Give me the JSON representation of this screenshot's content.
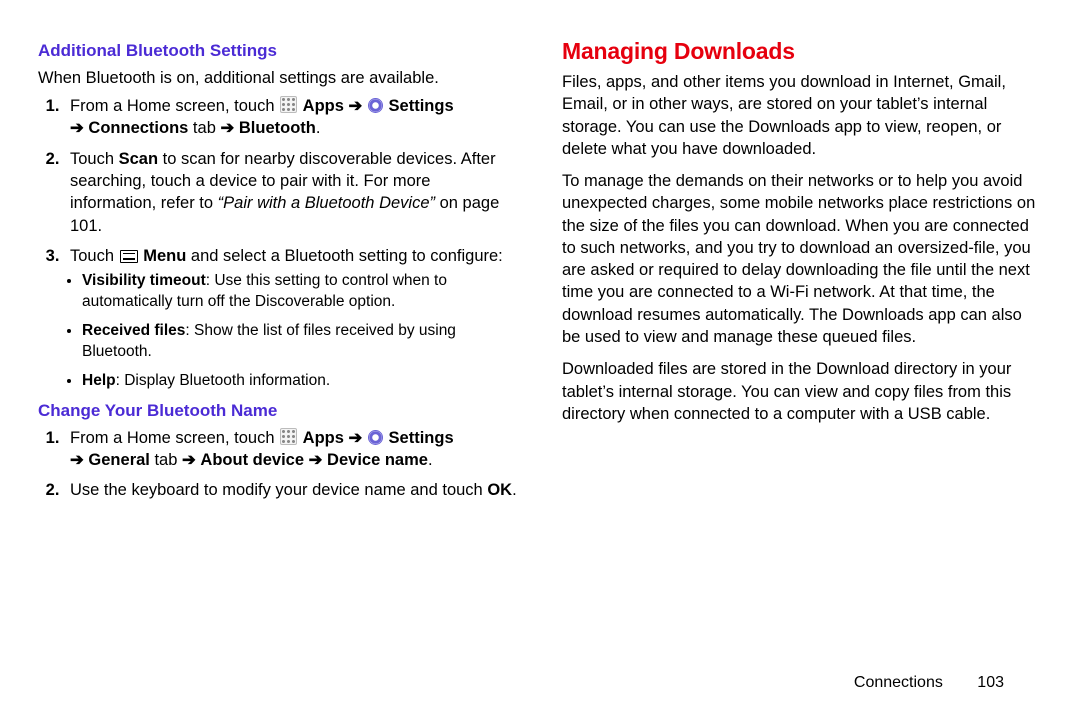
{
  "left": {
    "heading1": "Additional Bluetooth Settings",
    "intro1": "When Bluetooth is on, additional settings are available.",
    "step1_a": "From a Home screen, touch ",
    "apps": "Apps",
    "settings": "Settings",
    "step1_b": "Connections",
    "step1_c": " tab",
    "step1_d": "Bluetooth",
    "step2_a": "Touch ",
    "step2_scan": "Scan",
    "step2_b": " to scan for nearby discoverable devices. After searching, touch a device to pair with it. For more information, refer to ",
    "step2_ref": "“Pair with a Bluetooth Device”",
    "step2_c": " on page 101.",
    "step3_a": "Touch ",
    "step3_menu": "Menu",
    "step3_b": " and select a Bluetooth setting to configure:",
    "bullet1_t": "Visibility timeout",
    "bullet1_b": ": Use this setting to control when to automatically turn off the Discoverable option.",
    "bullet2_t": "Received files",
    "bullet2_b": ": Show the list of files received by using Bluetooth.",
    "bullet3_t": "Help",
    "bullet3_b": ": Display Bluetooth information.",
    "heading2": "Change Your Bluetooth Name",
    "cstep1_a": "From a Home screen, touch ",
    "cstep1_gen": "General",
    "cstep1_tab": " tab",
    "cstep1_about": "About device",
    "cstep1_dev": "Device name",
    "cstep2_a": "Use the keyboard to modify your device name and touch ",
    "cstep2_ok": "OK"
  },
  "right": {
    "heading": "Managing Downloads",
    "p1": "Files, apps, and other items you download in Internet, Gmail, Email, or in other ways, are stored on your tablet’s internal storage. You can use the Downloads app to view, reopen, or delete what you have downloaded.",
    "p2": "To manage the demands on their networks or to help you avoid unexpected charges, some mobile networks place restrictions on the size of the files you can download. When you are connected to such networks, and you try to download an oversized-file, you are asked or required to delay downloading the file until the next time you are connected to a Wi-Fi network. At that time, the download resumes automatically. The Downloads app can also be used to view and manage these queued files.",
    "p3": "Downloaded files are stored in the Download directory in your tablet’s internal storage. You can view and copy files from this directory when connected to a computer with a USB cable."
  },
  "footer": {
    "section": "Connections",
    "page": "103"
  },
  "arrow": "➔"
}
